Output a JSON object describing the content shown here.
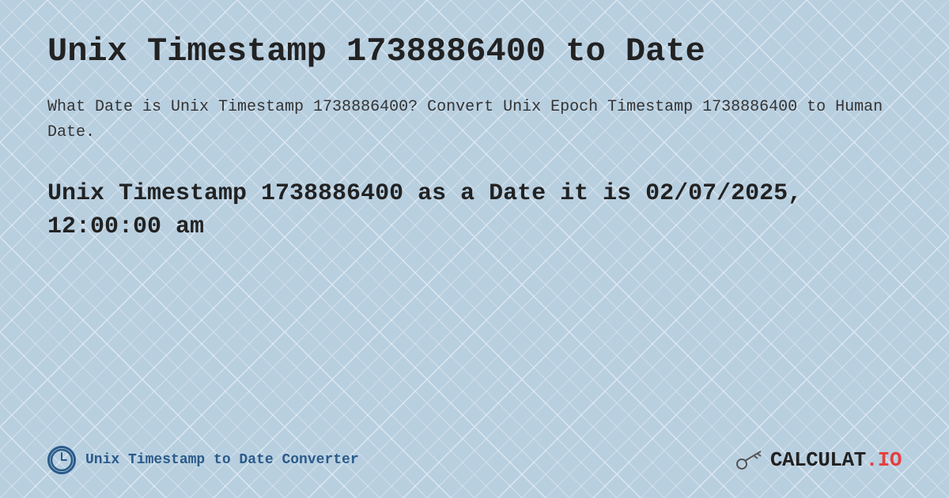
{
  "background": {
    "color": "#c8d8e8"
  },
  "header": {
    "title": "Unix Timestamp 1738886400 to Date"
  },
  "description": {
    "text": "What Date is Unix Timestamp 1738886400? Convert Unix Epoch Timestamp 1738886400 to Human Date."
  },
  "result": {
    "text": "Unix Timestamp 1738886400 as a Date it is 02/07/2025, 12:00:00 am"
  },
  "footer": {
    "label": "Unix Timestamp to Date Converter",
    "logo": "CALCULAT.IO"
  },
  "colors": {
    "title_color": "#222222",
    "accent_color": "#2a5a8a",
    "background": "#c8d8e8",
    "logo_red": "#e63e3e"
  }
}
